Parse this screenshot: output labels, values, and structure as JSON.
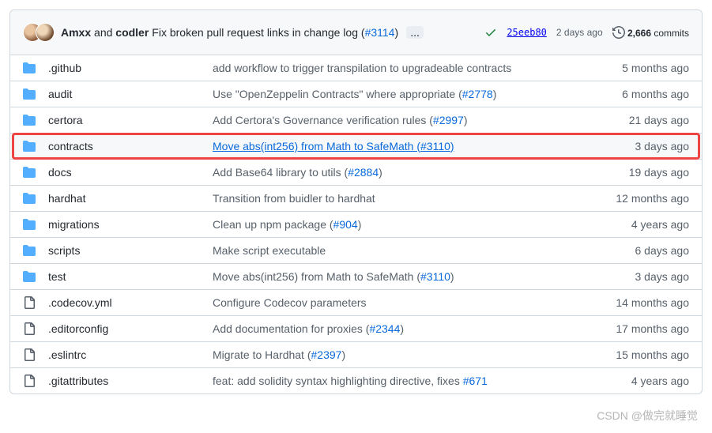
{
  "header": {
    "author1": "Amxx",
    "author_sep": " and ",
    "author2": "codler",
    "message": "Fix broken pull request links in change log (",
    "issue_label": "#3114",
    "issue_suffix": ")",
    "more": "…",
    "check_icon": "check",
    "hash": "25eeb80",
    "date": "2 days ago",
    "commits_count": "2,666",
    "commits_label": " commits"
  },
  "rows": [
    {
      "type": "dir",
      "name": ".github",
      "msg": "add workflow to trigger transpilation to upgradeable contracts",
      "issue": "",
      "date": "5 months ago",
      "highlight": false
    },
    {
      "type": "dir",
      "name": "audit",
      "msg": "Use \"OpenZeppelin Contracts\" where appropriate (",
      "issue": "#2778",
      "suffix": ")",
      "date": "6 months ago",
      "highlight": false
    },
    {
      "type": "dir",
      "name": "certora",
      "msg": "Add Certora's Governance verification rules (",
      "issue": "#2997",
      "suffix": ")",
      "date": "21 days ago",
      "highlight": false
    },
    {
      "type": "dir",
      "name": "contracts",
      "msg": "Move abs(int256) from Math to SafeMath (",
      "issue": "#3110",
      "suffix": ")",
      "date": "3 days ago",
      "highlight": true
    },
    {
      "type": "dir",
      "name": "docs",
      "msg": "Add Base64 library to utils (",
      "issue": "#2884",
      "suffix": ")",
      "date": "19 days ago",
      "highlight": false
    },
    {
      "type": "dir",
      "name": "hardhat",
      "msg": "Transition from buidler to hardhat",
      "issue": "",
      "date": "12 months ago",
      "highlight": false
    },
    {
      "type": "dir",
      "name": "migrations",
      "msg": "Clean up npm package (",
      "issue": "#904",
      "suffix": ")",
      "date": "4 years ago",
      "highlight": false
    },
    {
      "type": "dir",
      "name": "scripts",
      "msg": "Make script executable",
      "issue": "",
      "date": "6 days ago",
      "highlight": false
    },
    {
      "type": "dir",
      "name": "test",
      "msg": "Move abs(int256) from Math to SafeMath (",
      "issue": "#3110",
      "suffix": ")",
      "date": "3 days ago",
      "highlight": false
    },
    {
      "type": "file",
      "name": ".codecov.yml",
      "msg": "Configure Codecov parameters",
      "issue": "",
      "date": "14 months ago",
      "highlight": false
    },
    {
      "type": "file",
      "name": ".editorconfig",
      "msg": "Add documentation for proxies (",
      "issue": "#2344",
      "suffix": ")",
      "date": "17 months ago",
      "highlight": false
    },
    {
      "type": "file",
      "name": ".eslintrc",
      "msg": "Migrate to Hardhat (",
      "issue": "#2397",
      "suffix": ")",
      "date": "15 months ago",
      "highlight": false
    },
    {
      "type": "file",
      "name": ".gitattributes",
      "msg": "feat: add solidity syntax highlighting directive, fixes ",
      "issue": "#671",
      "suffix": "",
      "date": "4 years ago",
      "highlight": false
    }
  ],
  "watermark": "CSDN @做完就睡觉"
}
